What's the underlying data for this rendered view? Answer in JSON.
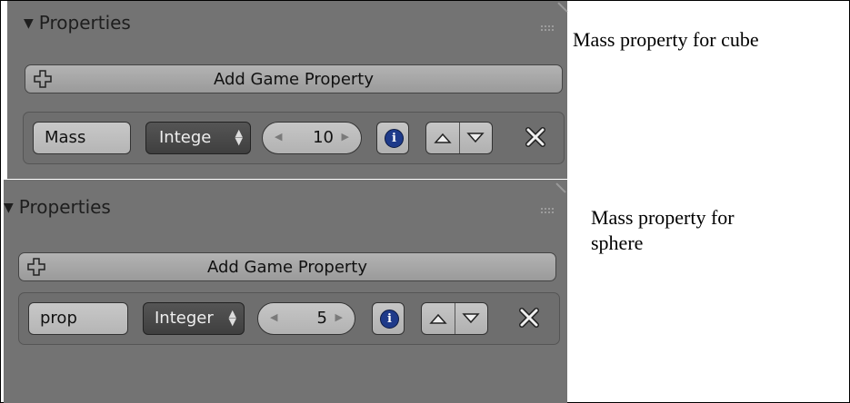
{
  "panels": [
    {
      "header": "Properties",
      "add_button_label": "Add Game Property",
      "property": {
        "name": "Mass",
        "type": "Intege",
        "value": "10"
      }
    },
    {
      "header": "Properties",
      "add_button_label": "Add Game Property",
      "property": {
        "name": "prop",
        "type": "Integer",
        "value": "5"
      }
    }
  ],
  "annotations": {
    "cube": "Mass property for cube",
    "sphere_line1": "Mass property for",
    "sphere_line2": "sphere"
  }
}
